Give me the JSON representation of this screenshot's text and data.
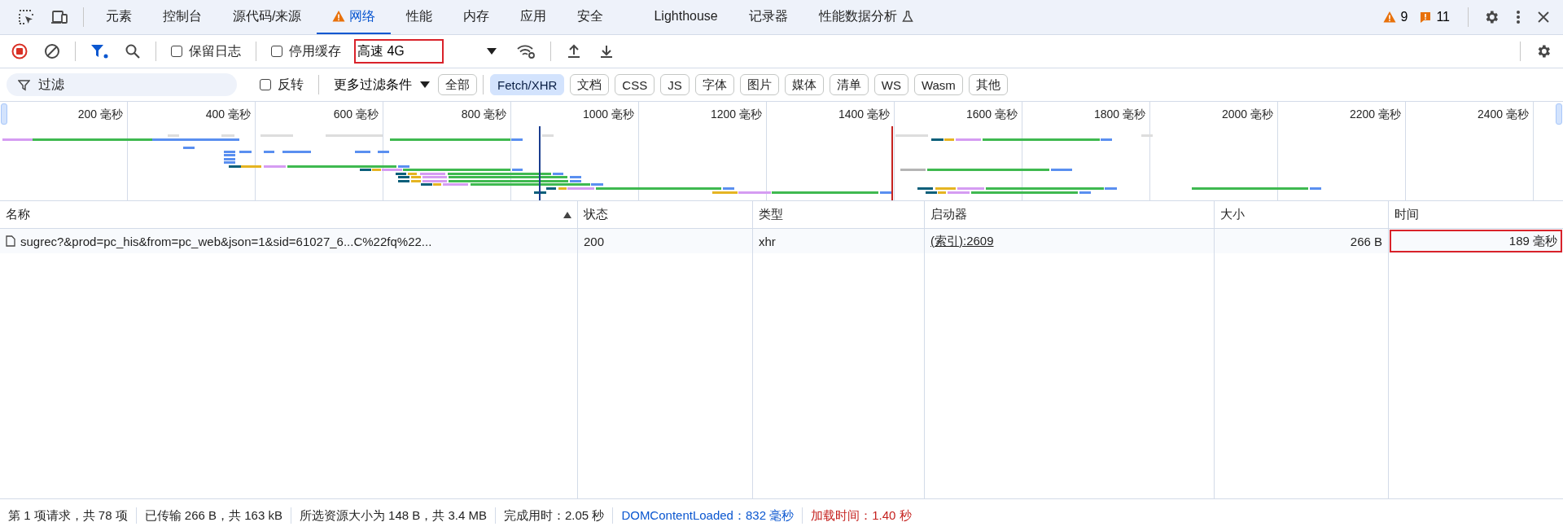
{
  "tabs": [
    {
      "label": "元素",
      "selected": false
    },
    {
      "label": "控制台",
      "selected": false
    },
    {
      "label": "源代码/来源",
      "selected": false
    },
    {
      "label": "网络",
      "selected": true,
      "warning": true
    },
    {
      "label": "性能",
      "selected": false
    },
    {
      "label": "内存",
      "selected": false
    },
    {
      "label": "应用",
      "selected": false
    },
    {
      "label": "安全",
      "selected": false
    },
    {
      "label": "Lighthouse",
      "selected": false
    },
    {
      "label": "记录器",
      "selected": false
    },
    {
      "label": "性能数据分析",
      "selected": false,
      "experimental": true
    }
  ],
  "issues": {
    "warnings": "9",
    "errors": "11"
  },
  "toolbar": {
    "recording": true,
    "filter_active": true,
    "checkboxes": [
      {
        "label": "保留日志",
        "checked": false
      },
      {
        "label": "停用缓存",
        "checked": false
      }
    ],
    "throttle": {
      "value": "高速 4G",
      "highlighted": true
    }
  },
  "filter_bar": {
    "placeholder": "过滤",
    "invert": {
      "label": "反转",
      "checked": false
    },
    "more_filters": "更多过滤条件",
    "types": [
      {
        "label": "全部",
        "selected": false
      },
      {
        "label": "Fetch/XHR",
        "selected": true
      },
      {
        "label": "文档",
        "selected": false
      },
      {
        "label": "CSS",
        "selected": false
      },
      {
        "label": "JS",
        "selected": false
      },
      {
        "label": "字体",
        "selected": false
      },
      {
        "label": "图片",
        "selected": false
      },
      {
        "label": "媒体",
        "selected": false
      },
      {
        "label": "清单",
        "selected": false
      },
      {
        "label": "WS",
        "selected": false
      },
      {
        "label": "Wasm",
        "selected": false
      },
      {
        "label": "其他",
        "selected": false
      }
    ]
  },
  "timeline": {
    "ticks": [
      "200 毫秒",
      "400 毫秒",
      "600 毫秒",
      "800 毫秒",
      "1000 毫秒",
      "1200 毫秒",
      "1400 毫秒",
      "1600 毫秒",
      "1800 毫秒",
      "2000 毫秒",
      "2200 毫秒",
      "2400 毫秒"
    ]
  },
  "table": {
    "columns": [
      {
        "label": "名称",
        "sorted": true
      },
      {
        "label": "状态",
        "sorted": false
      },
      {
        "label": "类型",
        "sorted": false
      },
      {
        "label": "启动器",
        "sorted": false
      },
      {
        "label": "大小",
        "sorted": false
      },
      {
        "label": "时间",
        "sorted": false
      }
    ],
    "rows": [
      {
        "name": "sugrec?&prod=pc_his&from=pc_web&json=1&sid=61027_6...C%22fq%22...",
        "status": "200",
        "type": "xhr",
        "initiator": "(索引):2609",
        "size": "266 B",
        "time": "189 毫秒",
        "time_highlighted": true
      }
    ]
  },
  "status_bar": [
    {
      "text": "第 1 项请求，共 78 项",
      "kind": "plain"
    },
    {
      "text": "已传输 266 B，共 163 kB",
      "kind": "plain"
    },
    {
      "text": "所选资源大小为 148 B，共 3.4 MB",
      "kind": "plain"
    },
    {
      "text": "完成用时：2.05 秒",
      "kind": "plain"
    },
    {
      "text": "DOMContentLoaded：832 毫秒",
      "kind": "dom"
    },
    {
      "text": "加载时间：1.40 秒",
      "kind": "load"
    }
  ]
}
